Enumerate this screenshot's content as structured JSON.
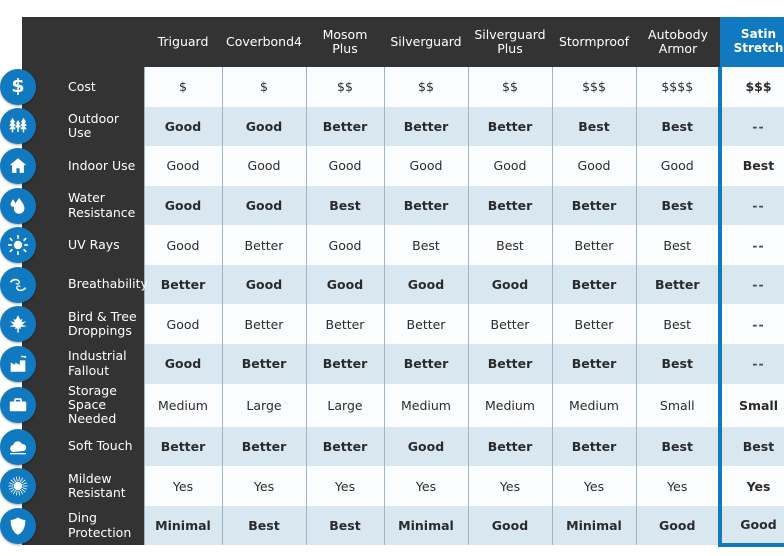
{
  "colors": {
    "panel_dark": "#333333",
    "accent_blue": "#1179bf",
    "row_light": "#fbfcfd",
    "row_tint": "#d8e7f0",
    "text_light": "#ffffff",
    "text_dark": "#2b2b2b"
  },
  "chart_data": {
    "type": "table",
    "title": "",
    "highlighted_column": "Satin Stretch",
    "columns": [
      {
        "label": "Triguard",
        "highlight": false
      },
      {
        "label": "Coverbond4",
        "highlight": false
      },
      {
        "label": "Mosom Plus",
        "highlight": false
      },
      {
        "label": "Silverguard",
        "highlight": false
      },
      {
        "label": "Silverguard Plus",
        "highlight": false
      },
      {
        "label": "Stormproof",
        "highlight": false
      },
      {
        "label": "Autobody Armor",
        "highlight": false
      },
      {
        "label": "Satin Stretch",
        "highlight": true
      }
    ],
    "rows": [
      {
        "label": "Cost",
        "icon": "dollar-icon",
        "values": [
          "$",
          "$",
          "$$",
          "$$",
          "$$",
          "$$$",
          "$$$$",
          "$$$"
        ]
      },
      {
        "label": "Outdoor Use",
        "icon": "trees-icon",
        "values": [
          "Good",
          "Good",
          "Better",
          "Better",
          "Better",
          "Best",
          "Best",
          "--"
        ]
      },
      {
        "label": "Indoor Use",
        "icon": "home-icon",
        "values": [
          "Good",
          "Good",
          "Good",
          "Good",
          "Good",
          "Good",
          "Good",
          "Best"
        ]
      },
      {
        "label": "Water Resistance",
        "icon": "water-drop-icon",
        "values": [
          "Good",
          "Good",
          "Best",
          "Better",
          "Better",
          "Better",
          "Best",
          "--"
        ]
      },
      {
        "label": "UV Rays",
        "icon": "sun-icon",
        "values": [
          "Good",
          "Better",
          "Good",
          "Best",
          "Best",
          "Better",
          "Best",
          "--"
        ]
      },
      {
        "label": "Breathability",
        "icon": "wind-icon",
        "values": [
          "Better",
          "Good",
          "Good",
          "Good",
          "Good",
          "Better",
          "Better",
          "--"
        ]
      },
      {
        "label": "Bird & Tree Droppings",
        "icon": "leaf-icon",
        "values": [
          "Good",
          "Better",
          "Better",
          "Better",
          "Better",
          "Better",
          "Best",
          "--"
        ]
      },
      {
        "label": "Industrial Fallout",
        "icon": "factory-icon",
        "values": [
          "Good",
          "Better",
          "Better",
          "Better",
          "Better",
          "Better",
          "Best",
          "--"
        ]
      },
      {
        "label": "Storage Space Needed",
        "icon": "briefcase-icon",
        "values": [
          "Medium",
          "Large",
          "Large",
          "Medium",
          "Medium",
          "Medium",
          "Small",
          "Small"
        ]
      },
      {
        "label": "Soft Touch",
        "icon": "cloud-icon",
        "values": [
          "Better",
          "Better",
          "Better",
          "Good",
          "Better",
          "Better",
          "Best",
          "Best"
        ]
      },
      {
        "label": "Mildew Resistant",
        "icon": "spore-icon",
        "values": [
          "Yes",
          "Yes",
          "Yes",
          "Yes",
          "Yes",
          "Yes",
          "Yes",
          "Yes"
        ]
      },
      {
        "label": "Ding Protection",
        "icon": "shield-icon",
        "values": [
          "Minimal",
          "Best",
          "Best",
          "Minimal",
          "Good",
          "Minimal",
          "Good",
          "Good"
        ]
      }
    ]
  }
}
